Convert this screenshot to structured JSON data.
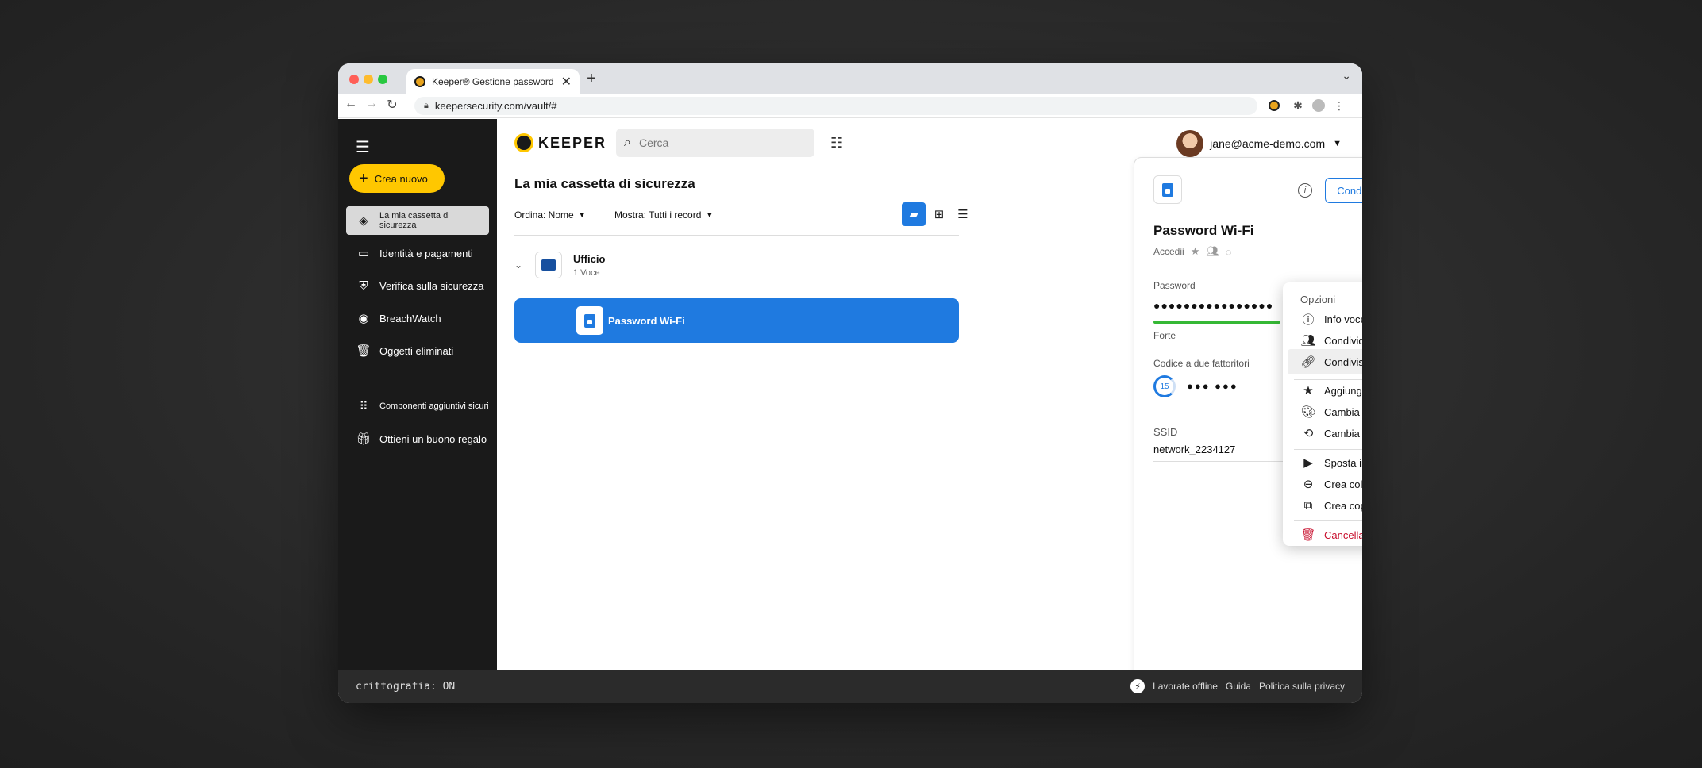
{
  "browser": {
    "tab_title": "Keeper® Gestione password e",
    "tab_close": "✕",
    "new_tab": "+",
    "url": "keepersecurity.com/vault/#"
  },
  "sidebar": {
    "create_label": "Crea nuovo",
    "items": [
      {
        "label": "La mia cassetta di sicurezza",
        "icon": "vault-icon"
      },
      {
        "label": "Identità e pagamenti",
        "icon": "card-icon"
      },
      {
        "label": "Verifica sulla sicurezza",
        "icon": "shield-icon"
      },
      {
        "label": "BreachWatch",
        "icon": "breachwatch-icon"
      },
      {
        "label": "Oggetti eliminati",
        "icon": "trash-icon"
      },
      {
        "label": "Componenti aggiuntivi sicuri",
        "icon": "grid-icon"
      },
      {
        "label": "Ottieni un buono regalo",
        "icon": "gift-icon"
      }
    ]
  },
  "header": {
    "logo_text": "KEEPER",
    "search_placeholder": "Cerca",
    "user_email": "jane@acme-demo.com"
  },
  "vault": {
    "title": "La mia cassetta di sicurezza",
    "sort_label": "Ordina: Nome",
    "show_label": "Mostra: Tutti i record",
    "folder_name": "Ufficio",
    "folder_count": "1 Voce",
    "record_name": "Password Wi-Fi"
  },
  "detail": {
    "share_label": "Condividi",
    "title": "Password Wi-Fi",
    "subtitle": "Accedii",
    "password_label": "Password",
    "password_mask": "●●●●●●●●●●●●●●●●",
    "strength_label": "Forte",
    "strength_color": "#35b835",
    "twofa_label": "Codice a due fattoritori",
    "totp_seconds": "15",
    "totp_mask": "●●● ●●●",
    "ssid_label": "SSID",
    "ssid_value": "network_2234127"
  },
  "menu": {
    "header": "Opzioni",
    "items": [
      {
        "label": "Info voce",
        "icon": "info-icon"
      },
      {
        "label": "Condividi",
        "icon": "people-icon"
      },
      {
        "label": "Condivisione singola",
        "icon": "link-person-icon"
      },
      {
        "label": "Aggiungi ai Preferiti",
        "icon": "star-icon"
      },
      {
        "label": "Cambia colore",
        "icon": "palette-icon"
      },
      {
        "label": "Cambia tipo",
        "icon": "change-type-icon"
      },
      {
        "label": "Sposta in",
        "icon": "move-folder-icon"
      },
      {
        "label": "Crea collegamento",
        "icon": "link-icon"
      },
      {
        "label": "Crea copia",
        "icon": "copy-icon"
      },
      {
        "label": "Cancella",
        "icon": "trash-icon"
      }
    ],
    "danger_color": "#c8102e"
  },
  "footer": {
    "crypto": "crittografia: ON",
    "offline": "Lavorate offline",
    "help": "Guida",
    "privacy": "Politica sulla privacy"
  },
  "colors": {
    "accent": "#1f7ae0",
    "brand_yellow": "#ffc700",
    "sidebar_bg": "#1a1a1a"
  }
}
